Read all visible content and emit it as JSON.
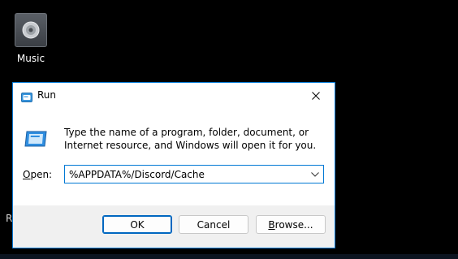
{
  "desktop": {
    "icon_label": "Music",
    "stray_text": "R"
  },
  "dialog": {
    "title": "Run",
    "description": "Type the name of a program, folder, document, or Internet resource, and Windows will open it for you.",
    "open_label_accel": "O",
    "open_label_rest": "pen:",
    "input_value": "%APPDATA%/Discord/Cache",
    "buttons": {
      "ok": "OK",
      "cancel": "Cancel",
      "browse_accel": "B",
      "browse_rest": "rowse..."
    }
  },
  "colors": {
    "accent": "#0078d4",
    "desktop_bg": "#000000",
    "dialog_bg": "#f0f0f0"
  },
  "icons": [
    "music-folder-icon",
    "run-app-icon",
    "close-icon",
    "run-program-icon",
    "chevron-down-icon"
  ]
}
